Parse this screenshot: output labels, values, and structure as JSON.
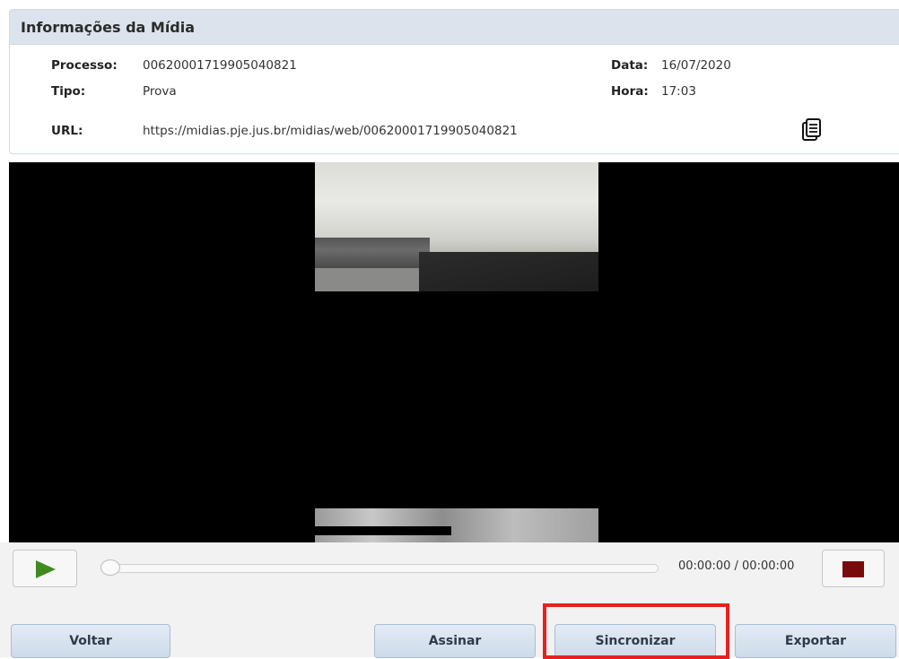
{
  "panel": {
    "title": "Informações da Mídia",
    "processo_label": "Processo:",
    "processo_value": "00620001719905040821",
    "tipo_label": "Tipo:",
    "tipo_value": "Prova",
    "url_label": "URL:",
    "url_value": "https://midias.pje.jus.br/midias/web/00620001719905040821",
    "data_label": "Data:",
    "data_value": "16/07/2020",
    "hora_label": "Hora:",
    "hora_value": "17:03",
    "copy_icon": "copy-icon"
  },
  "player": {
    "time": "00:00:00 / 00:00:00",
    "progress": 0,
    "play_icon": "play-icon",
    "stop_icon": "stop-icon"
  },
  "buttons": {
    "voltar": "Voltar",
    "assinar": "Assinar",
    "sincronizar": "Sincronizar",
    "exportar": "Exportar"
  },
  "colors": {
    "header_bg": "#dde3ec",
    "button_bg": "#cddbea",
    "play_green": "#3f8b1f",
    "stop_red": "#7a0a0a",
    "highlight": "#e8201e"
  }
}
